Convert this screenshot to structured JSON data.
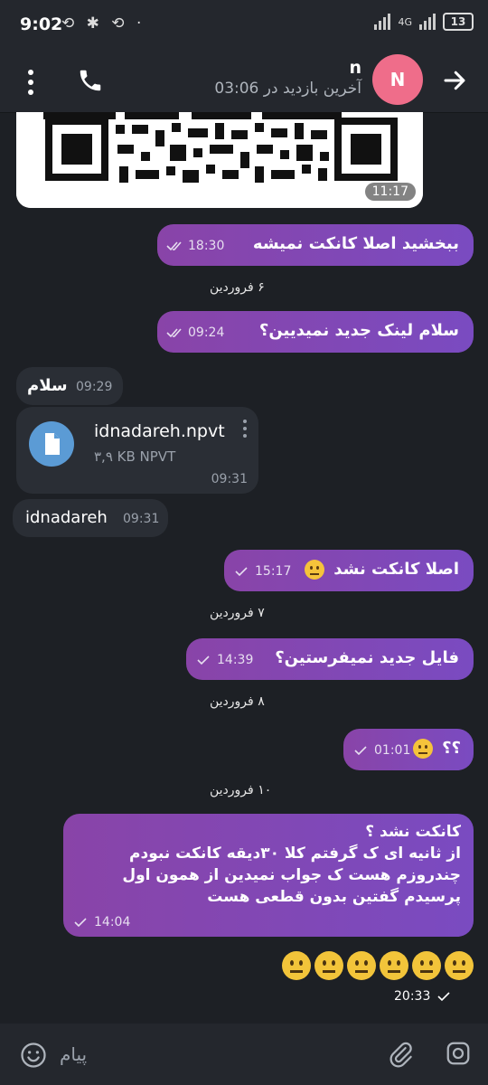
{
  "status_bar": {
    "time": "9:02",
    "left_icons": "⟲ ✱ ⟲ ·",
    "network": "4G",
    "battery": "13"
  },
  "header": {
    "contact_name": "n",
    "last_seen": "آخرین بازدید در 03:06",
    "avatar_letter": "N"
  },
  "messages": {
    "qr_time": "11:17",
    "m1_text": "ببخشید اصلا کانکت نمیشه",
    "m1_time": "18:30",
    "date1": "۶ فروردین",
    "m2_text": "سلام لینک جدید نمیدیین؟",
    "m2_time": "09:24",
    "m3_text": "سلام",
    "m3_time": "09:29",
    "file_name": "idnadareh.npvt",
    "file_size": "۳,۹ KB NPVT",
    "file_time": "09:31",
    "m4_text": "idnadareh",
    "m4_time": "09:31",
    "m5_text": "اصلا کانکت نشد",
    "m5_time": "15:17",
    "date2": "۷ فروردین",
    "m6_text": "فایل جدید نمیفرستین؟",
    "m6_time": "14:39",
    "date3": "۸ فروردین",
    "m7_text": "؟؟",
    "m7_time": "01:01",
    "date4": "۱۰ فروردین",
    "m8_line1": "کانکت نشد ؟",
    "m8_line2": "از ثانیه ای ک گرفتم کلا ۳۰دیقه کانکت نبودم",
    "m8_line3": "چندروزم هست ک جواب نمیدین از همون اول",
    "m8_line4": "پرسیدم گفتین بدون قطعی هست",
    "m8_time": "14:04",
    "m9_time": "20:33"
  },
  "input": {
    "placeholder": "پیام"
  },
  "colors": {
    "outgoing_bubble": "#8944a8",
    "incoming_bubble": "#2a2e35",
    "background": "#1d2025",
    "avatar": "#ef6d8a"
  }
}
